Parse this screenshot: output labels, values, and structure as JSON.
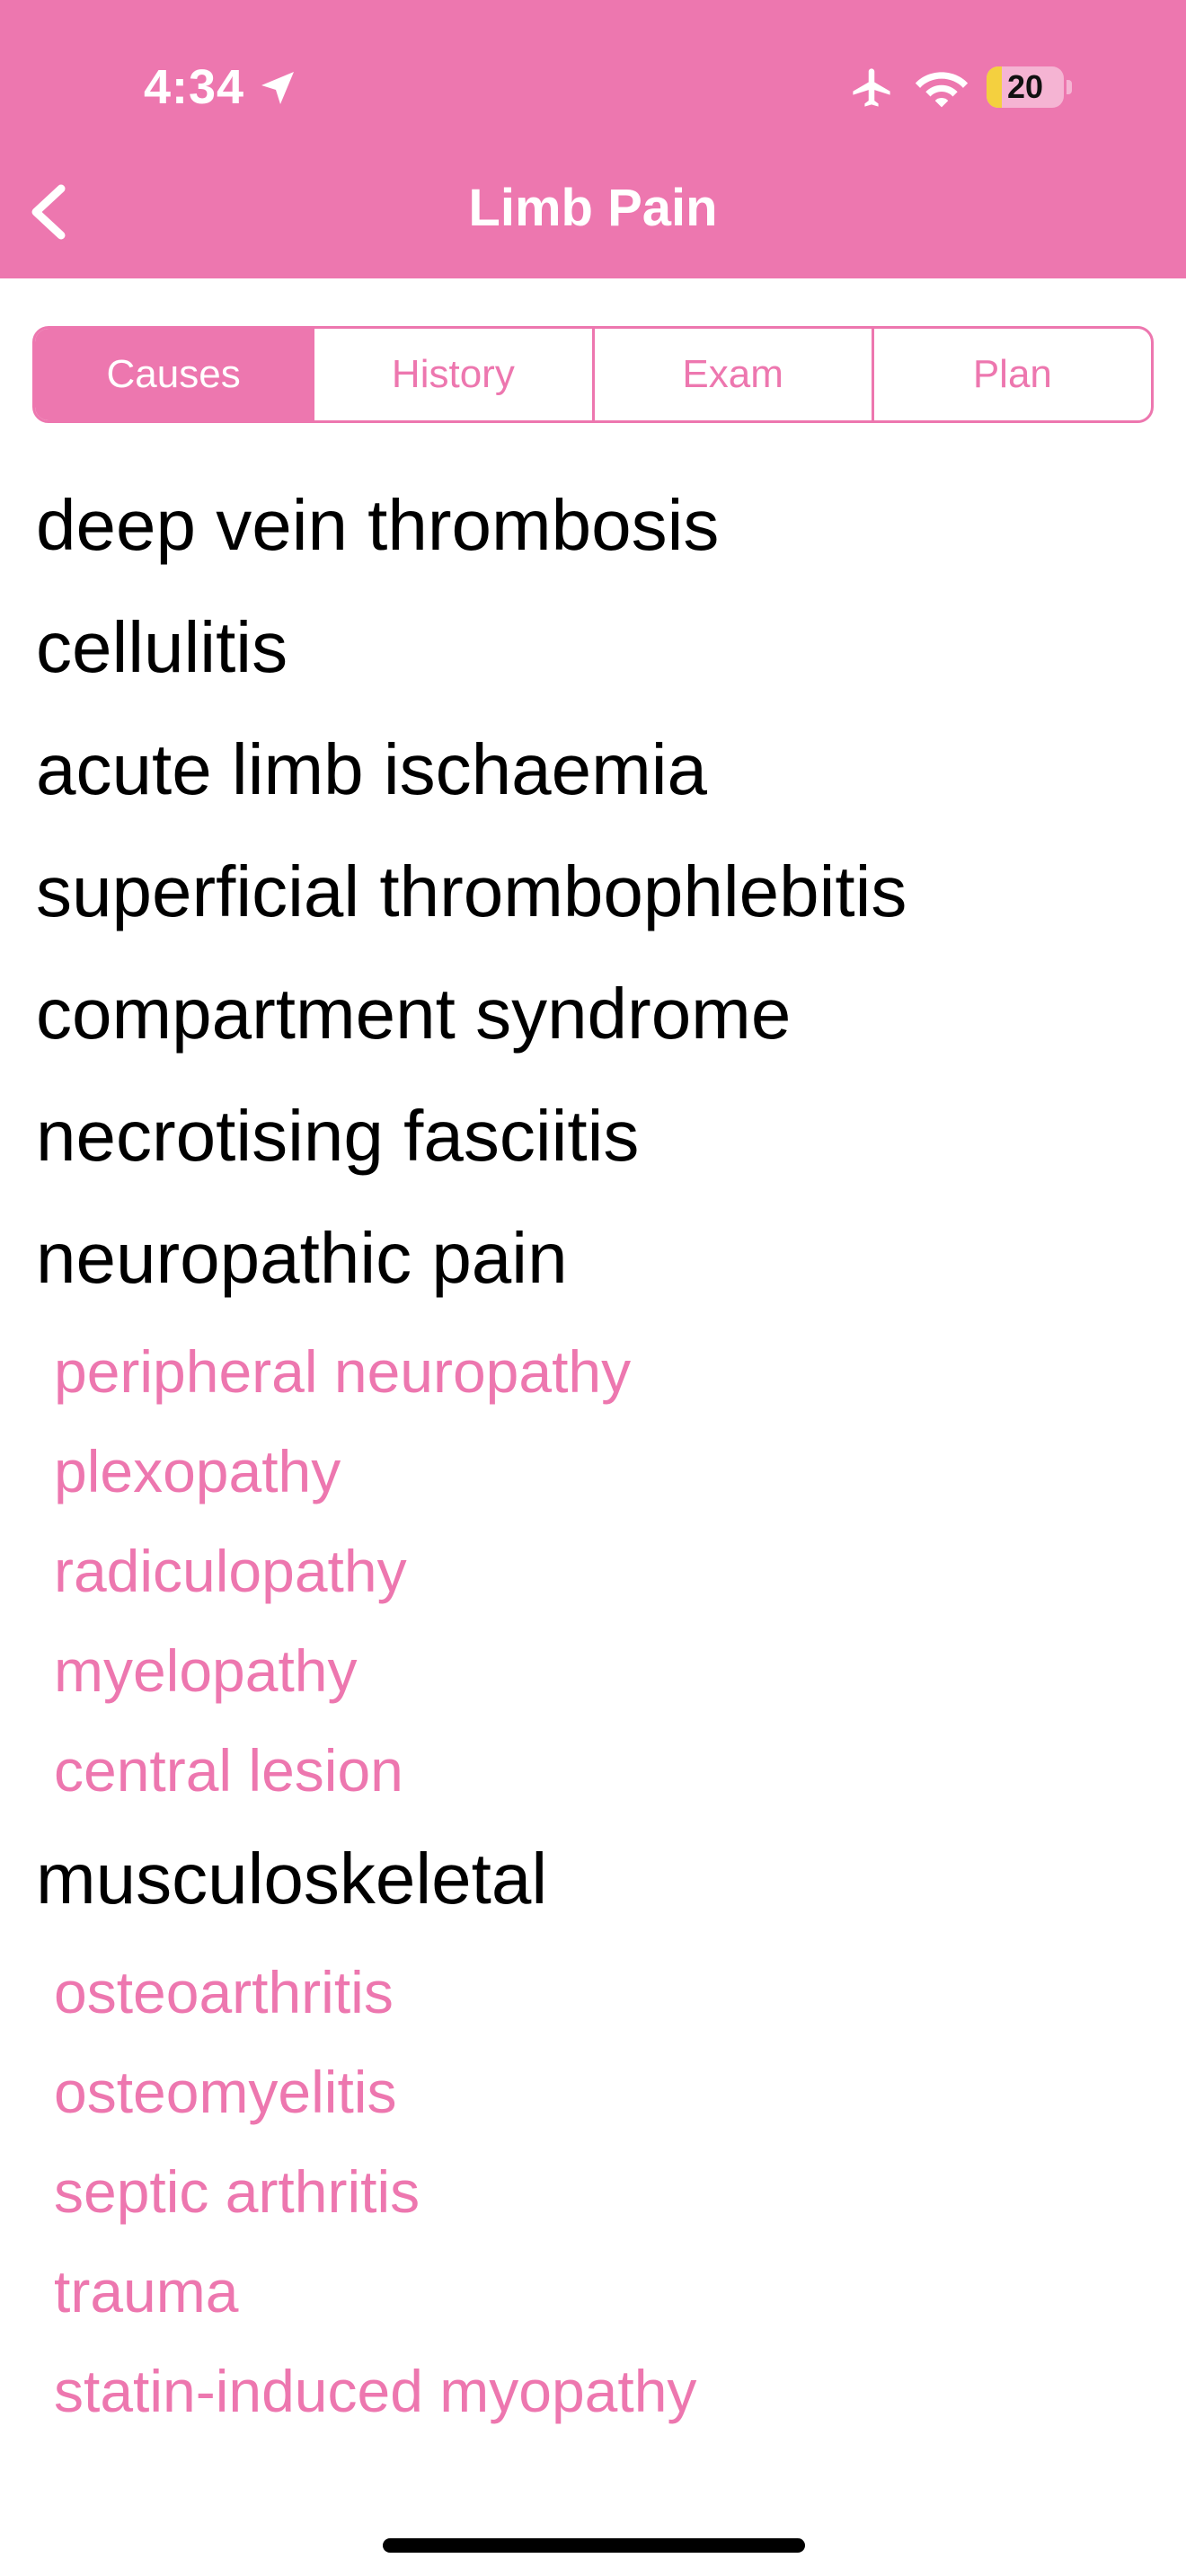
{
  "status_bar": {
    "time": "4:34",
    "battery_level": "20",
    "battery_fraction": 0.2,
    "icons": [
      "location-arrow-icon",
      "airplane-icon",
      "wifi-icon",
      "battery-icon"
    ]
  },
  "nav": {
    "title": "Limb Pain",
    "back_icon": "chevron-left-icon"
  },
  "tabs": [
    {
      "label": "Causes",
      "selected": true
    },
    {
      "label": "History",
      "selected": false
    },
    {
      "label": "Exam",
      "selected": false
    },
    {
      "label": "Plan",
      "selected": false
    }
  ],
  "causes": [
    {
      "text": "deep vein thrombosis",
      "level": "main"
    },
    {
      "text": "cellulitis",
      "level": "main"
    },
    {
      "text": "acute limb ischaemia",
      "level": "main"
    },
    {
      "text": "superficial thrombophlebitis",
      "level": "main"
    },
    {
      "text": "compartment syndrome",
      "level": "main"
    },
    {
      "text": "necrotising fasciitis",
      "level": "main"
    },
    {
      "text": "neuropathic pain",
      "level": "main"
    },
    {
      "text": "peripheral neuropathy",
      "level": "sub"
    },
    {
      "text": "plexopathy",
      "level": "sub"
    },
    {
      "text": "radiculopathy",
      "level": "sub"
    },
    {
      "text": "myelopathy",
      "level": "sub"
    },
    {
      "text": "central lesion",
      "level": "sub"
    },
    {
      "text": "musculoskeletal",
      "level": "main"
    },
    {
      "text": "osteoarthritis",
      "level": "sub"
    },
    {
      "text": "osteomyelitis",
      "level": "sub"
    },
    {
      "text": "septic arthritis",
      "level": "sub"
    },
    {
      "text": "trauma",
      "level": "sub"
    },
    {
      "text": "statin-induced myopathy",
      "level": "sub"
    }
  ],
  "colors": {
    "accent": "#ED77AF",
    "main_text": "#000000",
    "sub_text": "#ED77AF",
    "battery_fill": "#F4D03F"
  }
}
